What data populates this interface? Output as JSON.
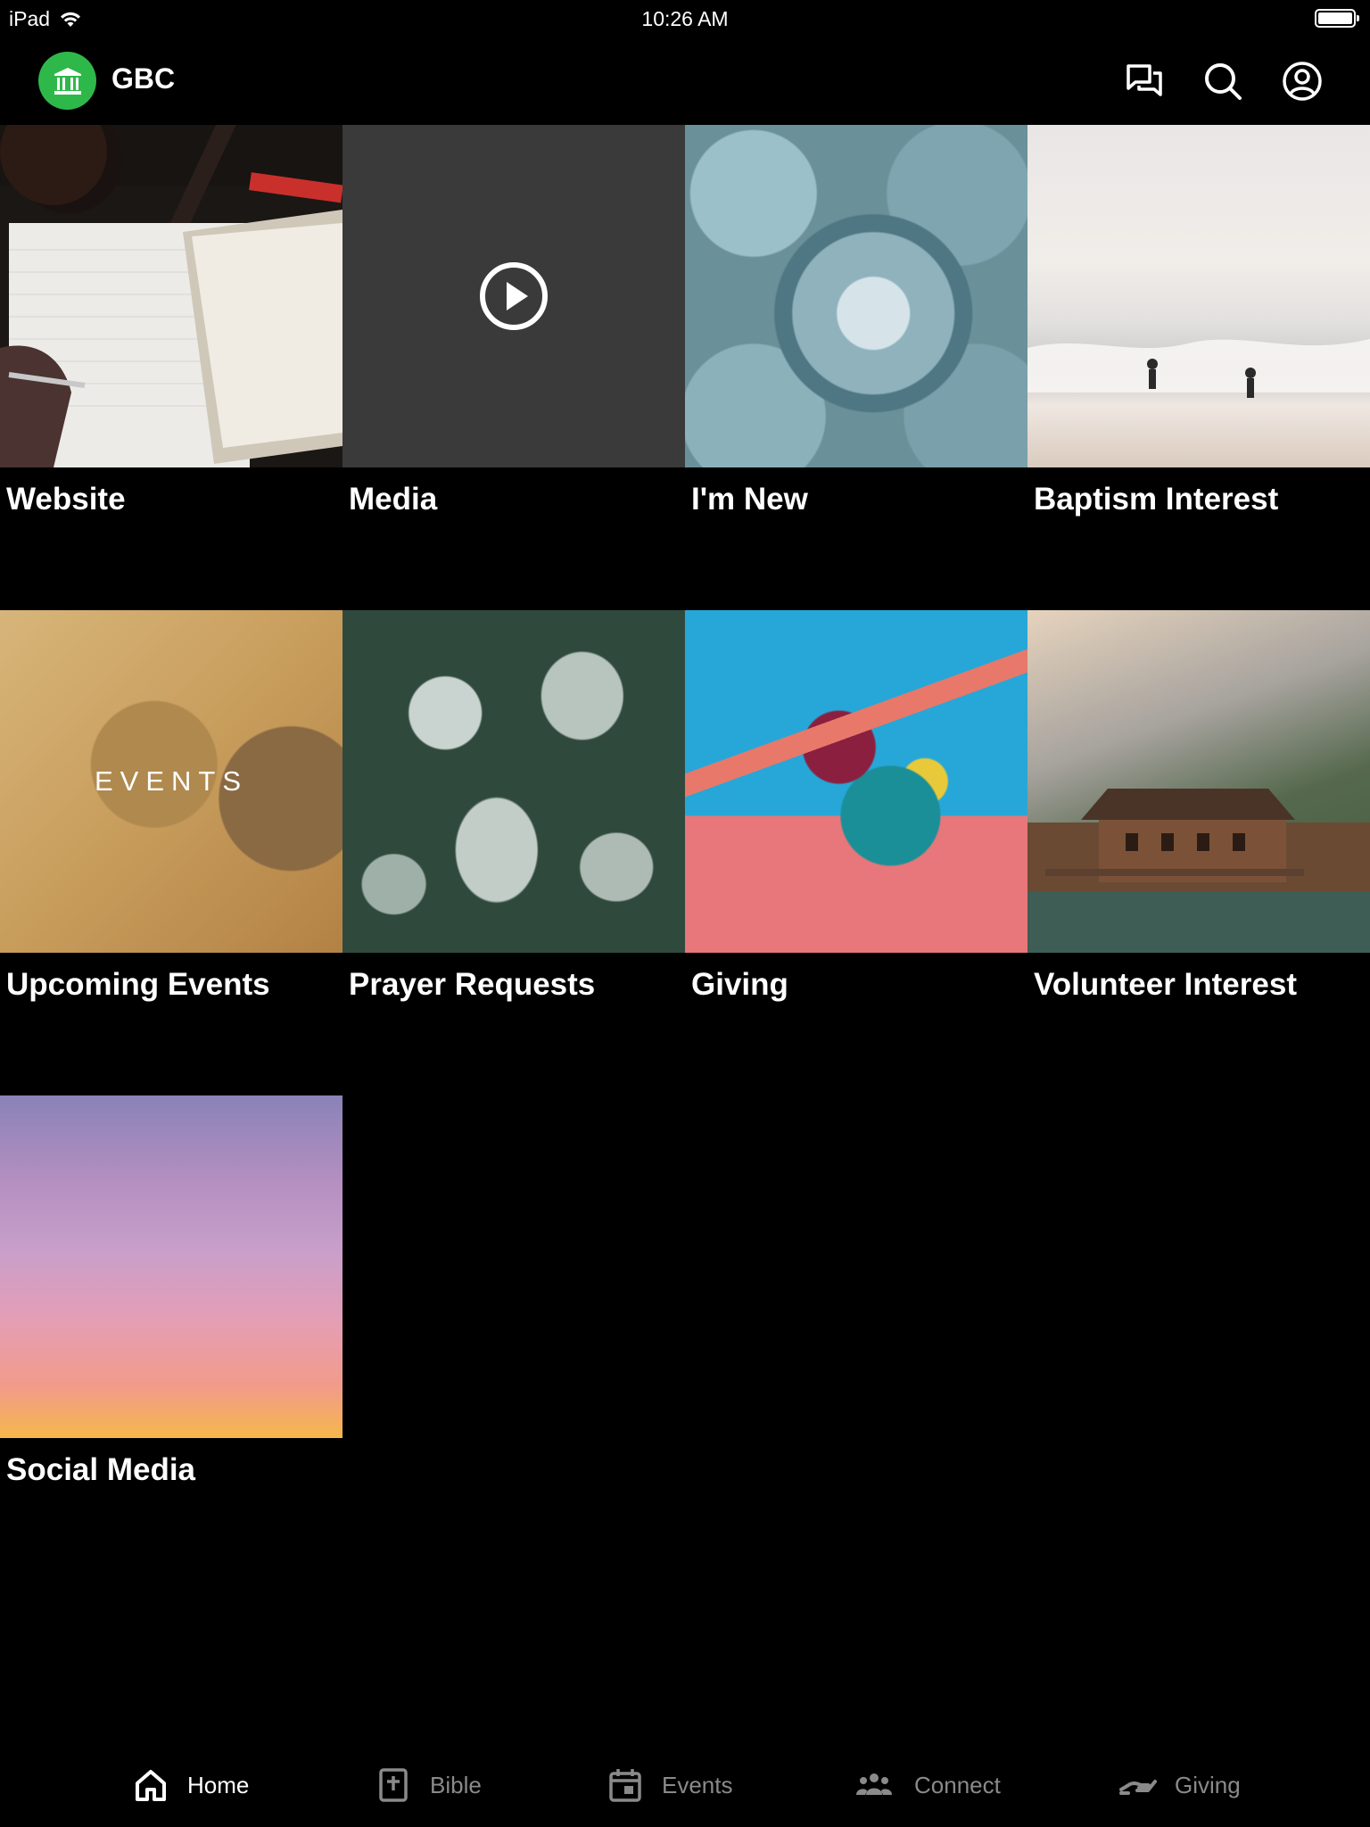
{
  "status_bar": {
    "device": "iPad",
    "time": "10:26 AM"
  },
  "header": {
    "app_title": "GBC",
    "logo_icon": "church-building-icon",
    "actions": [
      "messages-icon",
      "search-icon",
      "profile-icon"
    ]
  },
  "tiles": [
    {
      "label": "Website"
    },
    {
      "label": "Media"
    },
    {
      "label": "I'm New"
    },
    {
      "label": "Baptism Interest"
    },
    {
      "label": "Upcoming Events",
      "overlay_text": "EVENTS"
    },
    {
      "label": "Prayer Requests"
    },
    {
      "label": "Giving"
    },
    {
      "label": "Volunteer Interest"
    },
    {
      "label": "Social Media"
    }
  ],
  "tab_bar": {
    "items": [
      {
        "label": "Home",
        "icon": "home-icon",
        "active": true
      },
      {
        "label": "Bible",
        "icon": "bible-icon",
        "active": false
      },
      {
        "label": "Events",
        "icon": "calendar-icon",
        "active": false
      },
      {
        "label": "Connect",
        "icon": "people-icon",
        "active": false
      },
      {
        "label": "Giving",
        "icon": "giving-hand-icon",
        "active": false
      }
    ]
  },
  "colors": {
    "background": "#000000",
    "logo_green": "#2fb84a",
    "inactive_tab": "#8a8a8a"
  }
}
